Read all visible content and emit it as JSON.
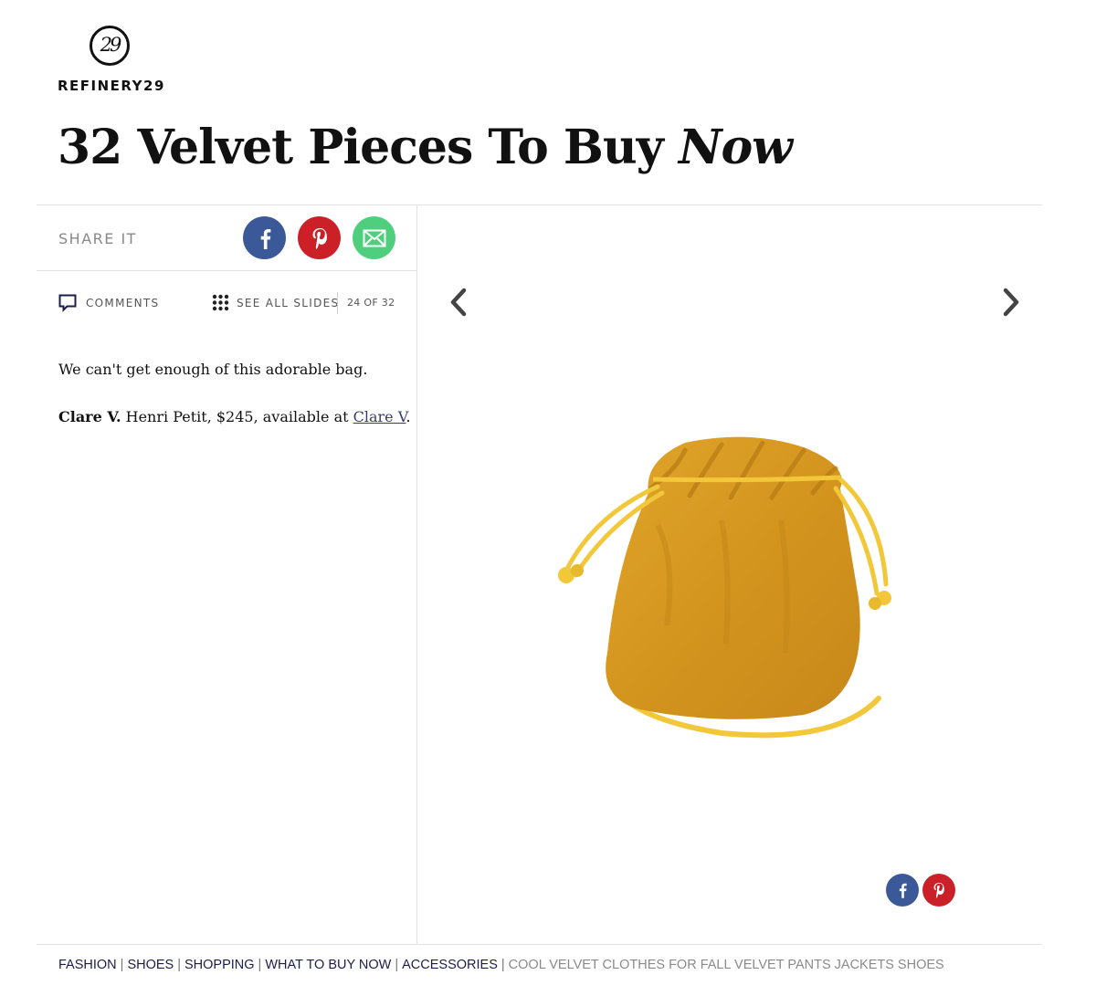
{
  "brand": {
    "mark_text": "29",
    "wordmark": "REFINERY29"
  },
  "article": {
    "title_main": "32 Velvet Pieces To Buy ",
    "title_emphasis": "Now"
  },
  "share": {
    "label": "SHARE IT"
  },
  "slideshow": {
    "comments_label": "COMMENTS",
    "see_all_label": "SEE ALL SLIDES",
    "counter": "24 OF 32"
  },
  "caption": {
    "description": "We can't get enough of this adorable bag.",
    "brand": "Clare V.",
    "product_text": " Henri Petit, $245, available at ",
    "link_text": "Clare V",
    "end": "."
  },
  "footer": {
    "tags": [
      "FASHION",
      "SHOES",
      "SHOPPING",
      "WHAT TO BUY NOW",
      "ACCESSORIES"
    ],
    "tail": "COOL VELVET CLOTHES FOR FALL VELVET PANTS JACKETS SHOES"
  },
  "colors": {
    "facebook": "#3b5998",
    "pinterest": "#cb2027",
    "email": "#4fcf7d",
    "bag_velvet": "#d79a22",
    "bag_cord": "#f2c83a"
  },
  "icons": [
    "facebook-icon",
    "pinterest-icon",
    "email-icon",
    "comment-icon",
    "grid-icon",
    "chevron-left-icon",
    "chevron-right-icon"
  ]
}
